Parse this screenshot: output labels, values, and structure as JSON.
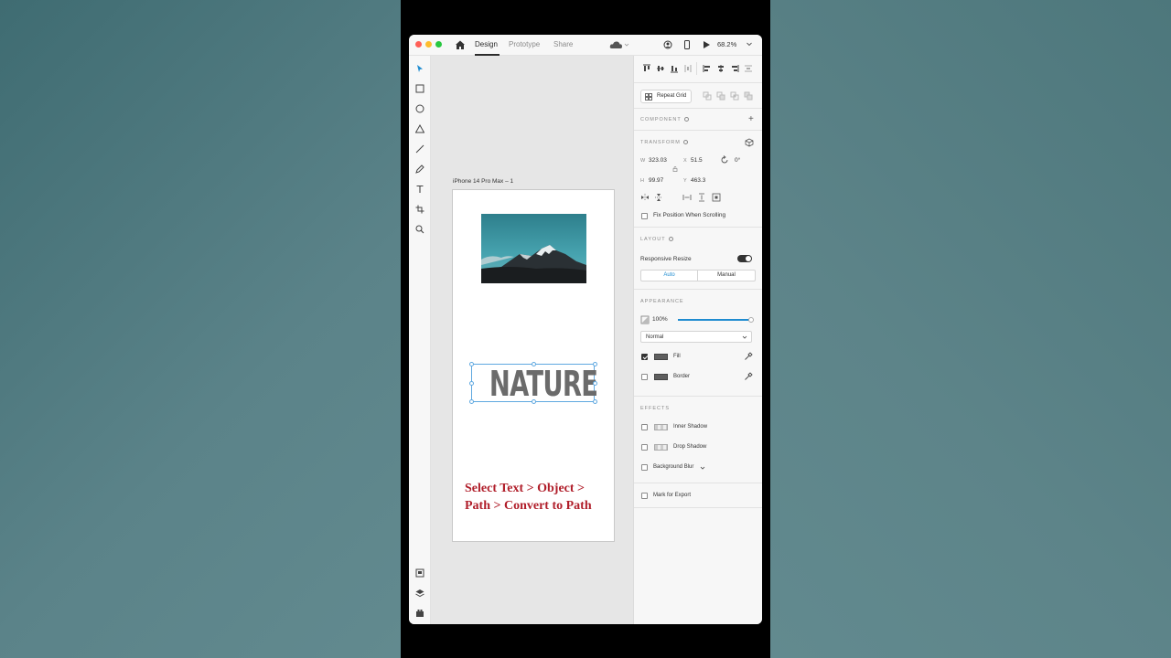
{
  "topbar": {
    "tabs": [
      "Design",
      "Prototype",
      "Share"
    ],
    "active_tab": "Design",
    "zoom": "68.2%"
  },
  "canvas": {
    "artboard_name": "iPhone 14 Pro Max – 1",
    "text_element": "NATURE",
    "instruction_line1": "Select Text > Object >",
    "instruction_line2": "Path > Convert to Path"
  },
  "panel": {
    "repeat_grid": "Repeat Grid",
    "component_title": "COMPONENT",
    "transform_title": "TRANSFORM",
    "w_label": "W",
    "w_value": "323.03",
    "x_label": "X",
    "x_value": "51.5",
    "rotation": "0°",
    "h_label": "H",
    "h_value": "99.97",
    "y_label": "Y",
    "y_value": "463.3",
    "fix_position": "Fix Position When Scrolling",
    "layout_title": "LAYOUT",
    "responsive_resize": "Responsive Resize",
    "resize_auto": "Auto",
    "resize_manual": "Manual",
    "appearance_title": "APPEARANCE",
    "opacity": "100%",
    "opacity_level": 1.0,
    "blend_mode": "Normal",
    "fill": "Fill",
    "border": "Border",
    "effects_title": "EFFECTS",
    "inner_shadow": "Inner Shadow",
    "drop_shadow": "Drop Shadow",
    "background_blur": "Background Blur",
    "mark_export": "Mark for Export"
  },
  "colors": {
    "accent": "#1f8cd0",
    "fill_swatch": "#5e5e5e",
    "instruction_text": "#b01e2a"
  }
}
